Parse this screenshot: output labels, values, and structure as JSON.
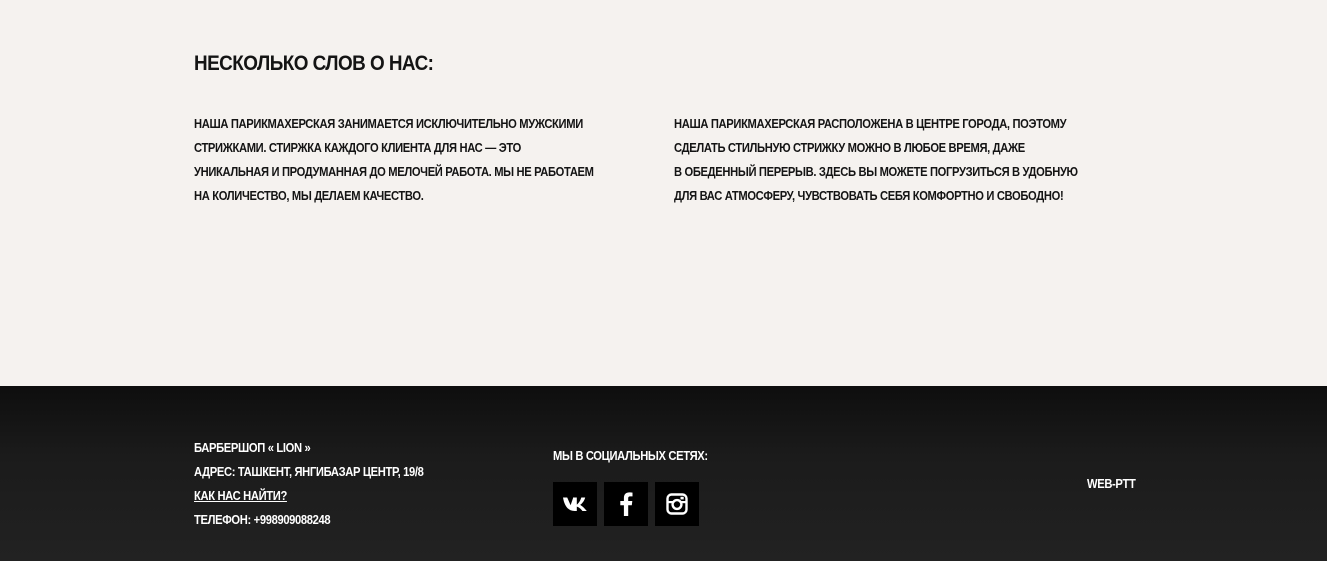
{
  "about": {
    "title": "НЕСКОЛЬКО СЛОВ О НАС:",
    "left_lines": [
      "НАША ПАРИКМАХЕРСКАЯ ЗАНИМАЕТСЯ ИСКЛЮЧИТЕЛЬНО МУЖСКИМИ",
      "СТРИЖКАМИ. СТИРЖКА КАЖДОГО КЛИЕНТА ДЛЯ НАС — ЭТО",
      "УНИКАЛЬНАЯ И ПРОДУМАННАЯ ДО МЕЛОЧЕЙ РАБОТА. МЫ НЕ РАБОТАЕМ",
      "НА КОЛИЧЕСТВО, МЫ ДЕЛАЕМ КАЧЕСТВО."
    ],
    "right_lines": [
      "НАША ПАРИКМАХЕРСКАЯ РАСПОЛОЖЕНА В ЦЕНТРЕ ГОРОДА, ПОЭТОМУ",
      "СДЕЛАТЬ СТИЛЬНУЮ СТРИЖКУ МОЖНО В ЛЮБОЕ ВРЕМЯ, ДАЖЕ",
      "В ОБЕДЕННЫЙ ПЕРЕРЫВ. ЗДЕСЬ ВЫ МОЖЕТЕ ПОГРУЗИТЬСЯ В УДОБНУЮ",
      "ДЛЯ ВАС АТМОСФЕРУ, ЧУВСТВОВАТЬ СЕБЯ КОМФОРТНО И СВОБОДНО!"
    ]
  },
  "footer": {
    "brand": "БАРБЕРШОП « LION »",
    "address": "АДРЕС: ТАШКЕНТ, ЯНГИБАЗАР ЦЕНТР, 19/8",
    "find_us_link": "КАК НАС НАЙТИ?",
    "phone": "ТЕЛЕФОН: +998909088248",
    "social_title": "МЫ В СОЦИАЛЬНЫХ СЕТЯХ:",
    "social_icons": [
      "vk-icon",
      "facebook-icon",
      "instagram-icon"
    ],
    "credit": "WEB-PTT"
  },
  "colors": {
    "page_background": "#f5f2ef",
    "text_dark": "#141414",
    "footer_background": "#1b1b1b",
    "footer_text": "#ffffff",
    "social_button": "#000000"
  }
}
